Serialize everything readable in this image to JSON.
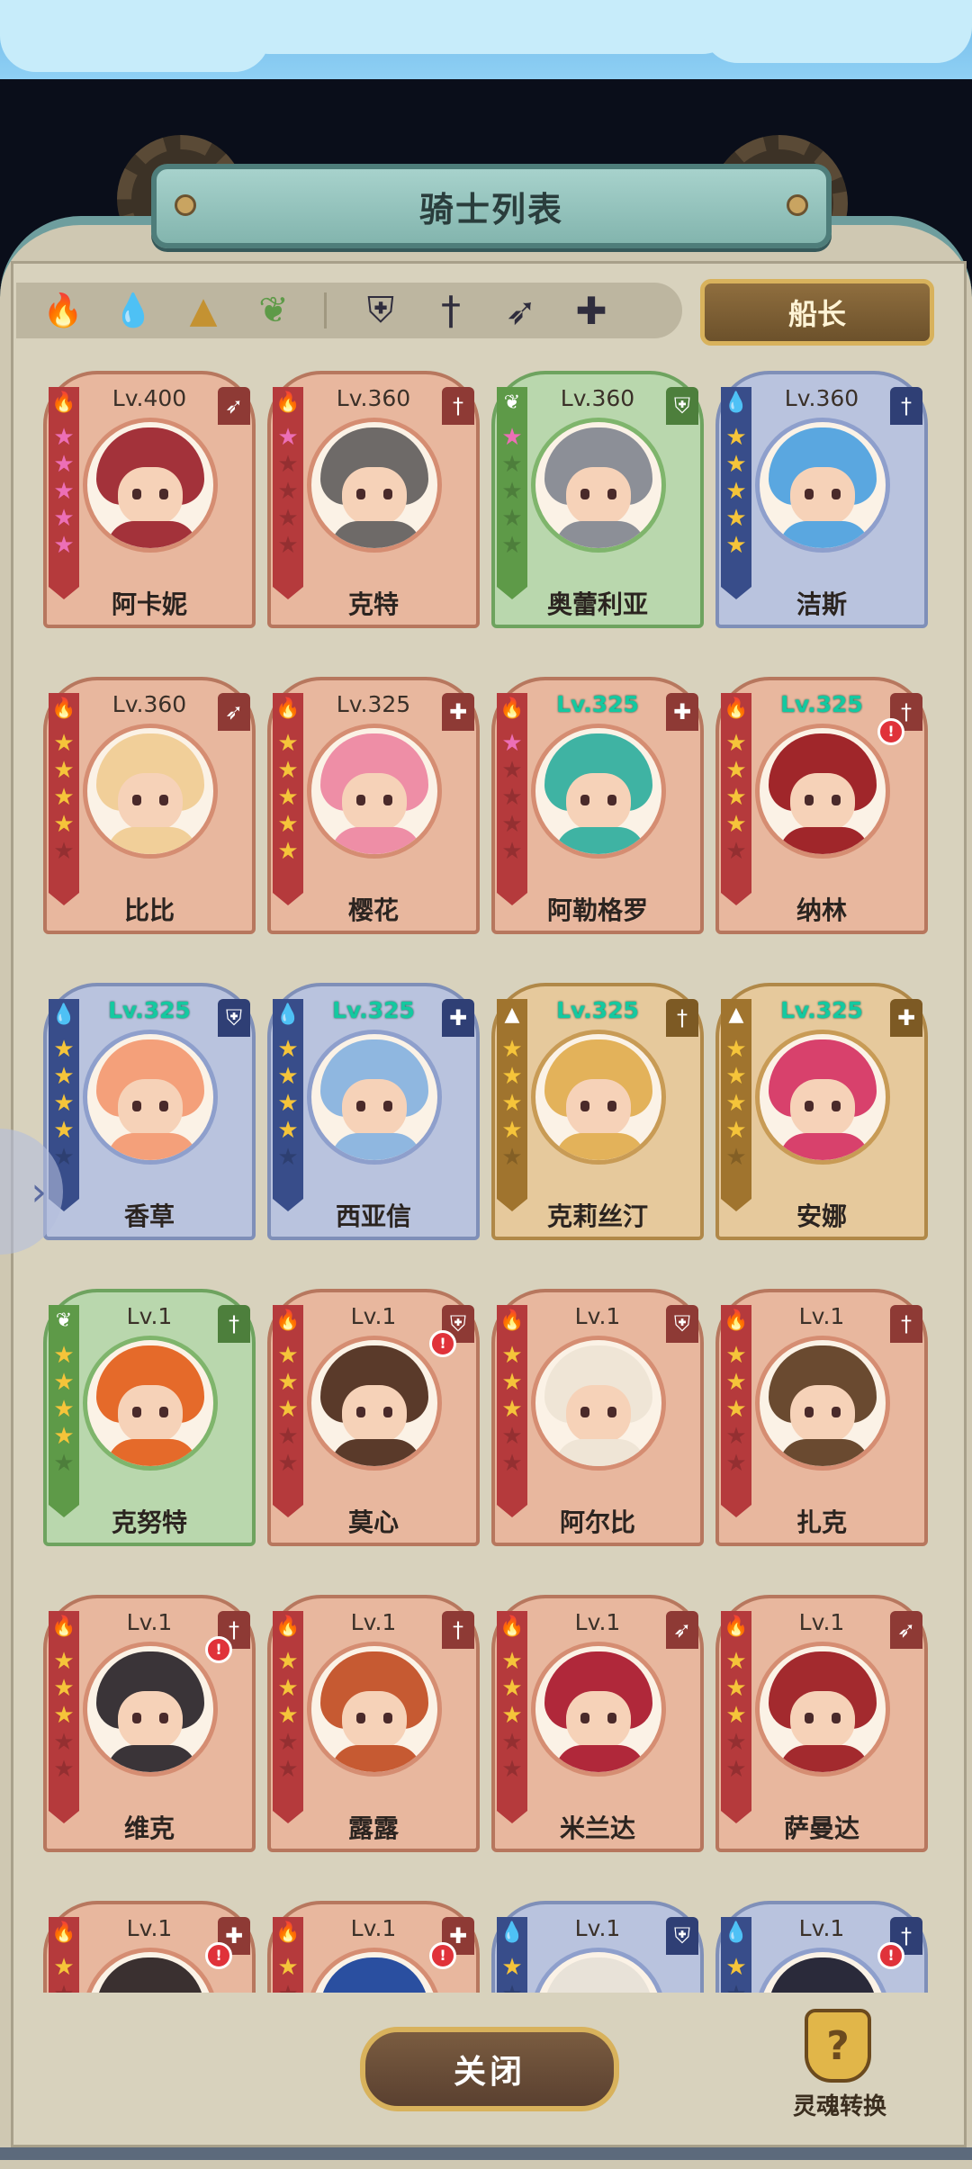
{
  "header": {
    "title": "骑士列表"
  },
  "filters": {
    "elements": [
      {
        "name": "fire",
        "icon": "🔥"
      },
      {
        "name": "water",
        "icon": "💧"
      },
      {
        "name": "earth",
        "icon": "▲"
      },
      {
        "name": "wind",
        "icon": "❦"
      }
    ],
    "classes": [
      {
        "name": "shield",
        "icon": "⛨"
      },
      {
        "name": "sword",
        "icon": "†"
      },
      {
        "name": "bow",
        "icon": "➶"
      },
      {
        "name": "support",
        "icon": "✚"
      }
    ],
    "captain_label": "船长"
  },
  "colors": {
    "fire": "#b53a3c",
    "water": "#384d8a",
    "wind": "#5e9a48",
    "earth": "#a0742e",
    "level_highlight": "#14c9a0"
  },
  "knights": [
    {
      "name": "阿卡妮",
      "level": "Lv.400",
      "element": "fire",
      "cls": "bow",
      "stars": 5,
      "star_color": "pink",
      "highlight": false,
      "alert": false,
      "hair": "#a3323a"
    },
    {
      "name": "克特",
      "level": "Lv.360",
      "element": "fire",
      "cls": "sword",
      "stars": 1,
      "star_color": "pink",
      "highlight": false,
      "alert": false,
      "hair": "#6e6a68"
    },
    {
      "name": "奥蕾利亚",
      "level": "Lv.360",
      "element": "wind",
      "cls": "shield",
      "stars": 1,
      "star_color": "pink",
      "highlight": false,
      "alert": false,
      "hair": "#8c8f97"
    },
    {
      "name": "洁斯",
      "level": "Lv.360",
      "element": "water",
      "cls": "sword",
      "stars": 5,
      "star_color": "gold",
      "highlight": false,
      "alert": false,
      "hair": "#5aa7e0"
    },
    {
      "name": "比比",
      "level": "Lv.360",
      "element": "fire",
      "cls": "bow",
      "stars": 4,
      "star_color": "gold",
      "highlight": false,
      "alert": false,
      "hair": "#f1cf99"
    },
    {
      "name": "樱花",
      "level": "Lv.325",
      "element": "fire",
      "cls": "support",
      "stars": 5,
      "star_color": "gold",
      "highlight": false,
      "alert": false,
      "hair": "#ee8ea6"
    },
    {
      "name": "阿勒格罗",
      "level": "Lv.325",
      "element": "fire",
      "cls": "support",
      "stars": 1,
      "star_color": "pink",
      "highlight": true,
      "alert": false,
      "hair": "#3fb3a3"
    },
    {
      "name": "纳林",
      "level": "Lv.325",
      "element": "fire",
      "cls": "sword",
      "stars": 4,
      "star_color": "gold",
      "highlight": true,
      "alert": true,
      "hair": "#a0262a"
    },
    {
      "name": "香草",
      "level": "Lv.325",
      "element": "water",
      "cls": "shield",
      "stars": 4,
      "star_color": "gold",
      "highlight": true,
      "alert": false,
      "hair": "#f4a07a"
    },
    {
      "name": "西亚信",
      "level": "Lv.325",
      "element": "water",
      "cls": "support",
      "stars": 4,
      "star_color": "gold",
      "highlight": true,
      "alert": false,
      "hair": "#8fb7e0"
    },
    {
      "name": "克莉丝汀",
      "level": "Lv.325",
      "element": "earth",
      "cls": "sword",
      "stars": 4,
      "star_color": "gold",
      "highlight": true,
      "alert": false,
      "hair": "#e3b25a"
    },
    {
      "name": "安娜",
      "level": "Lv.325",
      "element": "earth",
      "cls": "support",
      "stars": 4,
      "star_color": "gold",
      "highlight": true,
      "alert": false,
      "hair": "#d8416c"
    },
    {
      "name": "克努特",
      "level": "Lv.1",
      "element": "wind",
      "cls": "sword",
      "stars": 4,
      "star_color": "gold",
      "highlight": false,
      "alert": false,
      "hair": "#e56a2a"
    },
    {
      "name": "莫心",
      "level": "Lv.1",
      "element": "fire",
      "cls": "shield",
      "stars": 3,
      "star_color": "gold",
      "highlight": false,
      "alert": true,
      "hair": "#5a3a2a"
    },
    {
      "name": "阿尔比",
      "level": "Lv.1",
      "element": "fire",
      "cls": "shield",
      "stars": 3,
      "star_color": "gold",
      "highlight": false,
      "alert": false,
      "hair": "#efe5d6"
    },
    {
      "name": "扎克",
      "level": "Lv.1",
      "element": "fire",
      "cls": "sword",
      "stars": 3,
      "star_color": "gold",
      "highlight": false,
      "alert": false,
      "hair": "#6a4a30"
    },
    {
      "name": "维克",
      "level": "Lv.1",
      "element": "fire",
      "cls": "sword",
      "stars": 3,
      "star_color": "gold",
      "highlight": false,
      "alert": true,
      "hair": "#3a3438"
    },
    {
      "name": "露露",
      "level": "Lv.1",
      "element": "fire",
      "cls": "sword",
      "stars": 3,
      "star_color": "gold",
      "highlight": false,
      "alert": false,
      "hair": "#c65a32"
    },
    {
      "name": "米兰达",
      "level": "Lv.1",
      "element": "fire",
      "cls": "bow",
      "stars": 3,
      "star_color": "gold",
      "highlight": false,
      "alert": false,
      "hair": "#b0283a"
    },
    {
      "name": "萨曼达",
      "level": "Lv.1",
      "element": "fire",
      "cls": "bow",
      "stars": 3,
      "star_color": "gold",
      "highlight": false,
      "alert": false,
      "hair": "#a32a2e"
    },
    {
      "name": "",
      "level": "Lv.1",
      "element": "fire",
      "cls": "support",
      "stars": 1,
      "star_color": "gold",
      "highlight": false,
      "alert": true,
      "hair": "#3a3030"
    },
    {
      "name": "",
      "level": "Lv.1",
      "element": "fire",
      "cls": "support",
      "stars": 1,
      "star_color": "gold",
      "highlight": false,
      "alert": true,
      "hair": "#2a4fa0"
    },
    {
      "name": "",
      "level": "Lv.1",
      "element": "water",
      "cls": "shield",
      "stars": 1,
      "star_color": "gold",
      "highlight": false,
      "alert": false,
      "hair": "#e8e2d8"
    },
    {
      "name": "",
      "level": "Lv.1",
      "element": "water",
      "cls": "sword",
      "stars": 1,
      "star_color": "gold",
      "highlight": false,
      "alert": true,
      "hair": "#2a2a3a"
    }
  ],
  "footer": {
    "close_label": "关闭",
    "soul_label": "灵魂转换",
    "soul_icon": "?"
  },
  "nav": {
    "side_arrow": "›"
  }
}
